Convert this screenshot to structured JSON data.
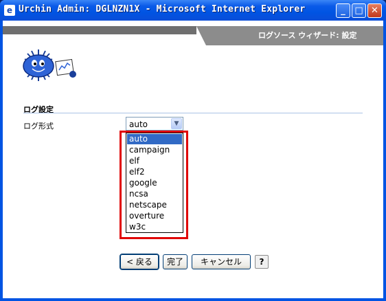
{
  "window": {
    "title": "Urchin Admin: DGLNZN1X - Microsoft Internet Explorer",
    "minimize_glyph": "_",
    "maximize_glyph": "□",
    "close_glyph": "✕"
  },
  "header": {
    "text": "ログソース ウィザード: 設定"
  },
  "logo": {
    "icon": "urchin-mascot-icon"
  },
  "section": {
    "title": "ログ設定"
  },
  "form": {
    "log_format_label": "ログ形式",
    "log_format_value": "auto",
    "dropdown_glyph": "▼",
    "options": [
      "auto",
      "campaign",
      "elf",
      "elf2",
      "google",
      "ncsa",
      "netscape",
      "overture",
      "w3c"
    ],
    "selected_index": 0
  },
  "buttons": {
    "back": "< 戻る",
    "finish": "完了",
    "cancel": "キャンセル",
    "help": "?"
  },
  "colors": {
    "highlight": "#e00000",
    "selection": "#316ac5",
    "titlebar": "#0054e3"
  }
}
